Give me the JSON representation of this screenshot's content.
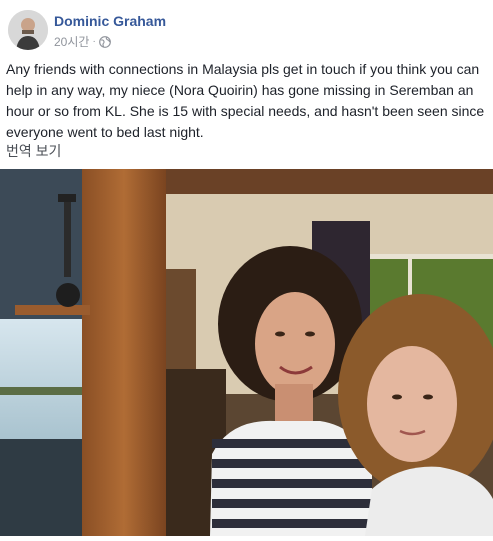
{
  "post": {
    "author": "Dominic Graham",
    "timestamp": "20시간",
    "separator": "·",
    "privacy_icon": "globe-icon",
    "text": "Any friends with connections in Malaysia pls get in touch if you think you can help in any way, my niece (Nora Quoirin) has gone missing in Seremban an hour or so from KL. She is 15 with special needs, and hasn't been seen since everyone went to bed last night.",
    "translate_label": "번역 보기"
  },
  "colors": {
    "author_link": "#365899",
    "meta_text": "#90949c",
    "body_text": "#1d2129"
  }
}
